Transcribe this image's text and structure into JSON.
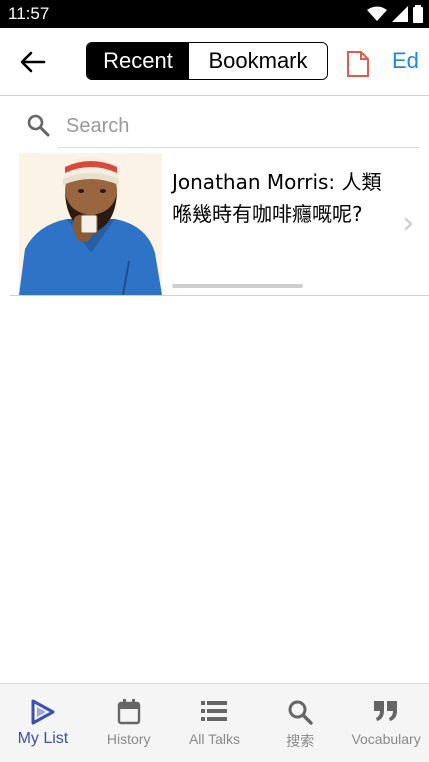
{
  "status_bar": {
    "time": "11:57"
  },
  "app_bar": {
    "segments": [
      {
        "label": "Recent",
        "active": true
      },
      {
        "label": "Bookmark",
        "active": false
      }
    ],
    "edit_label": "Ed"
  },
  "search": {
    "placeholder": "Search",
    "value": ""
  },
  "list": [
    {
      "title": "Jonathan Morris: 人類喺幾時有咖啡癮嘅呢?",
      "progress": 0.0
    }
  ],
  "tabs": [
    {
      "label": "My List",
      "icon": "play-triangle-icon",
      "active": true
    },
    {
      "label": "History",
      "icon": "calendar-icon",
      "active": false
    },
    {
      "label": "All Talks",
      "icon": "list-icon",
      "active": false
    },
    {
      "label": "搜索",
      "icon": "search-icon",
      "active": false
    },
    {
      "label": "Vocabulary",
      "icon": "quote-icon",
      "active": false
    }
  ],
  "colors": {
    "accent": "#3d4fb5",
    "edit_blue": "#1e88e5",
    "pdf_red": "#e05a4f"
  }
}
